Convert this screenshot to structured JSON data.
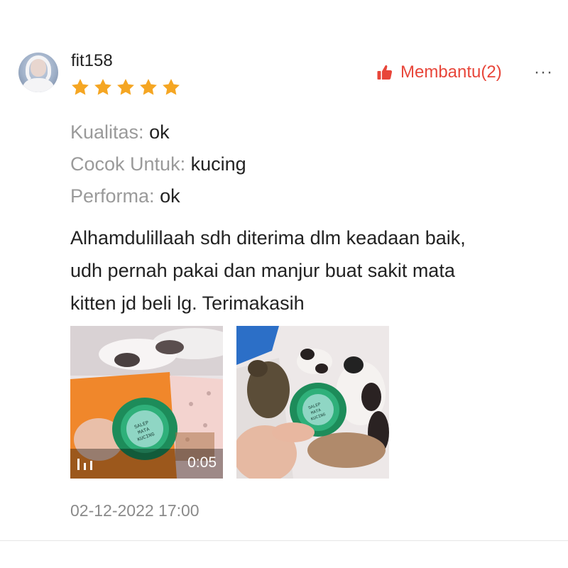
{
  "review": {
    "username": "fit158",
    "rating": 5,
    "rating_max": 5,
    "star_color": "#f5a623",
    "helpful": {
      "label": "Membantu(2)",
      "icon": "thumbs-up-icon",
      "color": "#e8463a"
    },
    "more_label": "···",
    "attributes": [
      {
        "key": "Kualitas:",
        "value": "ok"
      },
      {
        "key": "Cocok Untuk:",
        "value": "kucing"
      },
      {
        "key": "Performa:",
        "value": "ok"
      }
    ],
    "comment_lines": [
      "Alhamdulillaah sdh diterima dlm keadaan baik,",
      "udh pernah pakai dan manjur buat sakit mata",
      "kitten jd beli lg. Terimakasih"
    ],
    "media": [
      {
        "type": "video",
        "duration": "0:05",
        "jar_label": "SALEP MATA KUCING THE CAT"
      },
      {
        "type": "image",
        "jar_label": "SALEP MATA KUCING THE CAT"
      }
    ],
    "date": "02-12-2022 17:00"
  }
}
